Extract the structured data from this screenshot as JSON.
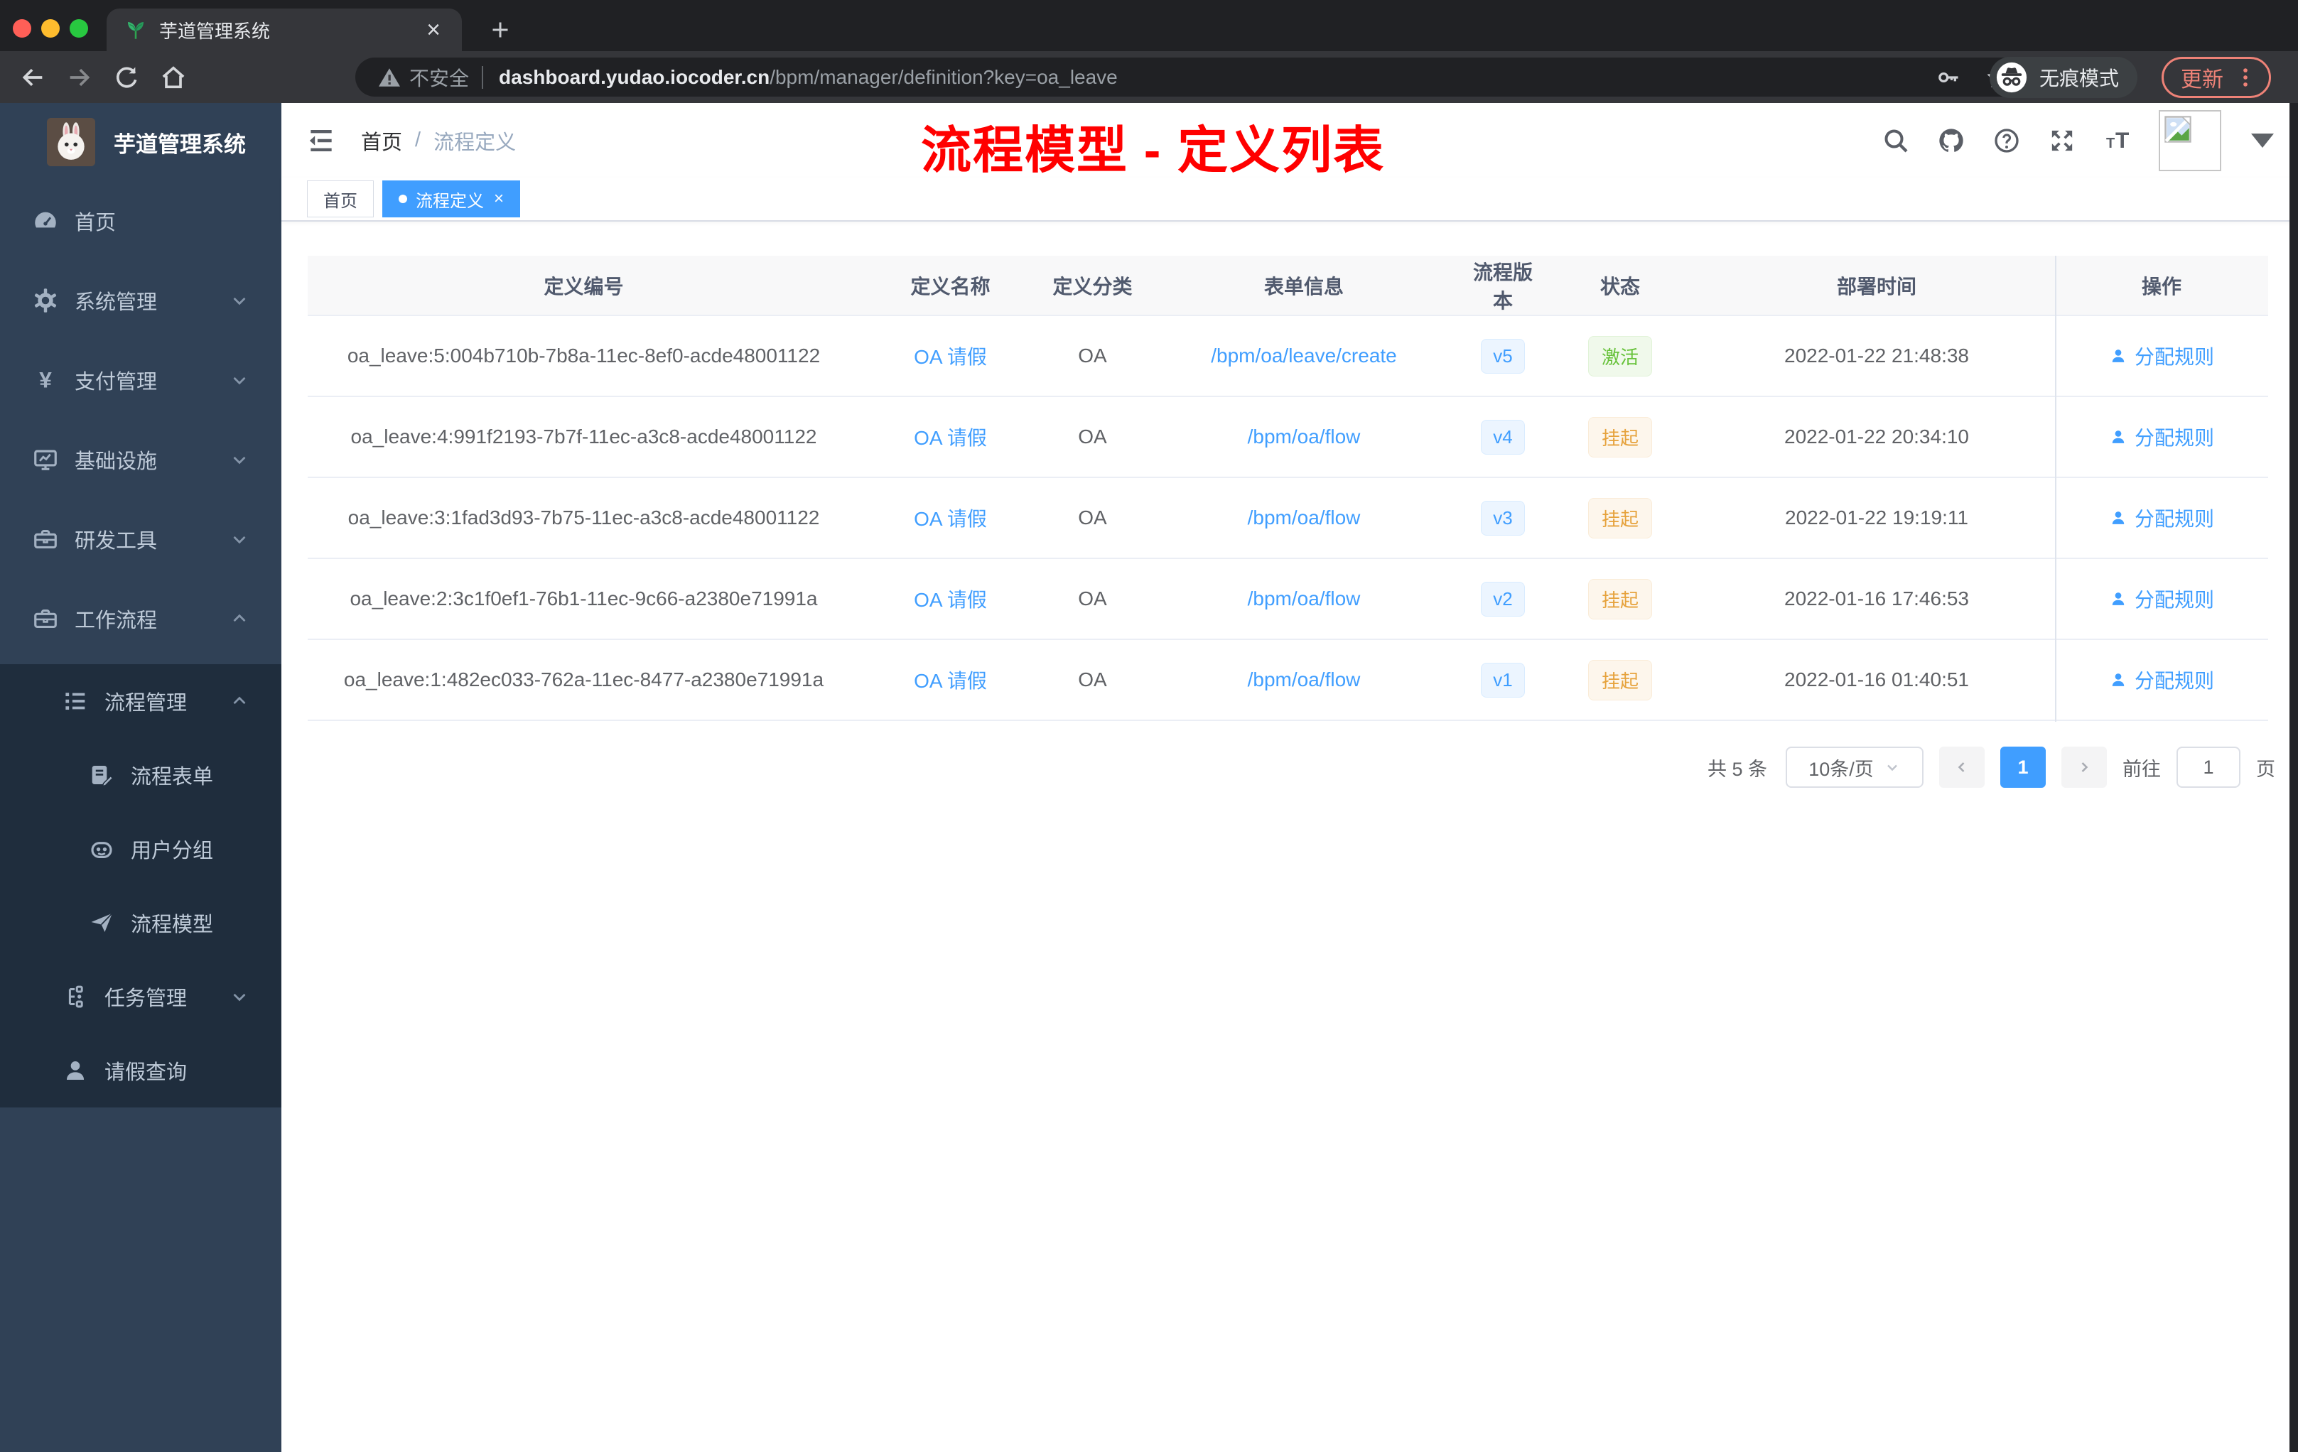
{
  "colors": {
    "accent": "#409eff",
    "success": "#67c23a",
    "warning": "#e6a23c",
    "annotation": "#ff0000",
    "sidebar_bg": "#304156",
    "submenu_bg": "#1f2d3d",
    "update_pill": "#ee8277",
    "traffic": [
      "#ff5f57",
      "#febc2e",
      "#28c840"
    ]
  },
  "browser": {
    "tab_title": "芋道管理系统",
    "security_label": "不安全",
    "url_domain": "dashboard.yudao.iocoder.cn",
    "url_path": "/bpm/manager/definition?key=oa_leave",
    "incognito_label": "无痕模式",
    "update_label": "更新"
  },
  "sidebar": {
    "title": "芋道管理系统",
    "items": [
      {
        "label": "首页",
        "icon": "gauge",
        "depth": 0,
        "arrow": "none",
        "sub": false
      },
      {
        "label": "系统管理",
        "icon": "gear",
        "depth": 0,
        "arrow": "down",
        "sub": false
      },
      {
        "label": "支付管理",
        "icon": "yen",
        "depth": 0,
        "arrow": "down",
        "sub": false
      },
      {
        "label": "基础设施",
        "icon": "monitor",
        "depth": 0,
        "arrow": "down",
        "sub": false
      },
      {
        "label": "研发工具",
        "icon": "toolbox",
        "depth": 0,
        "arrow": "down",
        "sub": false
      },
      {
        "label": "工作流程",
        "icon": "toolbox",
        "depth": 0,
        "arrow": "up",
        "sub": false
      },
      {
        "label": "流程管理",
        "icon": "list-tree",
        "depth": 1,
        "arrow": "up",
        "sub": true
      },
      {
        "label": "流程表单",
        "icon": "form",
        "depth": 2,
        "arrow": "none",
        "sub": true
      },
      {
        "label": "用户分组",
        "icon": "robot",
        "depth": 2,
        "arrow": "none",
        "sub": true
      },
      {
        "label": "流程模型",
        "icon": "plane",
        "depth": 2,
        "arrow": "none",
        "sub": true
      },
      {
        "label": "任务管理",
        "icon": "org",
        "depth": 1,
        "arrow": "down",
        "sub": true
      },
      {
        "label": "请假查询",
        "icon": "person",
        "depth": 1,
        "arrow": "none",
        "sub": true
      }
    ]
  },
  "header": {
    "breadcrumb": {
      "home": "首页",
      "separator": "/",
      "current": "流程定义"
    },
    "annotation": "流程模型 - 定义列表"
  },
  "tags": [
    {
      "label": "首页",
      "active": false,
      "closable": false
    },
    {
      "label": "流程定义",
      "active": true,
      "closable": true
    }
  ],
  "table": {
    "columns": [
      "定义编号",
      "定义名称",
      "定义分类",
      "表单信息",
      "流程版本",
      "状态",
      "部署时间",
      "操作"
    ],
    "action_label": "分配规则",
    "rows": [
      {
        "id": "oa_leave:5:004b710b-7b8a-11ec-8ef0-acde48001122",
        "name": "OA 请假",
        "category": "OA",
        "form": "/bpm/oa/leave/create",
        "version": "v5",
        "status": "激活",
        "status_type": "success",
        "deploy_time": "2022-01-22 21:48:38"
      },
      {
        "id": "oa_leave:4:991f2193-7b7f-11ec-a3c8-acde48001122",
        "name": "OA 请假",
        "category": "OA",
        "form": "/bpm/oa/flow",
        "version": "v4",
        "status": "挂起",
        "status_type": "warning",
        "deploy_time": "2022-01-22 20:34:10"
      },
      {
        "id": "oa_leave:3:1fad3d93-7b75-11ec-a3c8-acde48001122",
        "name": "OA 请假",
        "category": "OA",
        "form": "/bpm/oa/flow",
        "version": "v3",
        "status": "挂起",
        "status_type": "warning",
        "deploy_time": "2022-01-22 19:19:11"
      },
      {
        "id": "oa_leave:2:3c1f0ef1-76b1-11ec-9c66-a2380e71991a",
        "name": "OA 请假",
        "category": "OA",
        "form": "/bpm/oa/flow",
        "version": "v2",
        "status": "挂起",
        "status_type": "warning",
        "deploy_time": "2022-01-16 17:46:53"
      },
      {
        "id": "oa_leave:1:482ec033-762a-11ec-8477-a2380e71991a",
        "name": "OA 请假",
        "category": "OA",
        "form": "/bpm/oa/flow",
        "version": "v1",
        "status": "挂起",
        "status_type": "warning",
        "deploy_time": "2022-01-16 01:40:51"
      }
    ]
  },
  "pagination": {
    "total_text": "共 5 条",
    "page_size": "10条/页",
    "current_page": "1",
    "goto_label": "前往",
    "goto_value": "1",
    "page_unit": "页"
  }
}
